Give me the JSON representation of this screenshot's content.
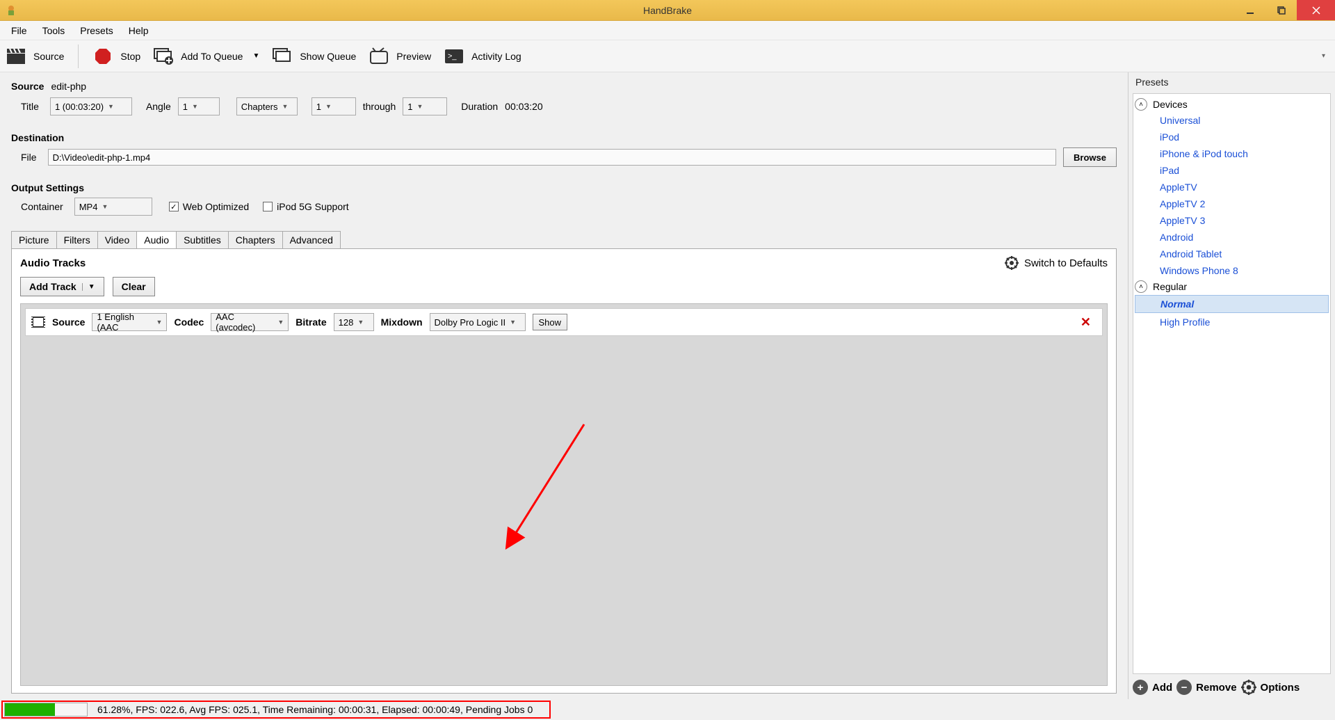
{
  "titlebar": {
    "title": "HandBrake"
  },
  "menubar": {
    "items": [
      "File",
      "Tools",
      "Presets",
      "Help"
    ]
  },
  "toolbar": {
    "source": "Source",
    "stop": "Stop",
    "addToQueue": "Add To Queue",
    "showQueue": "Show Queue",
    "preview": "Preview",
    "activityLog": "Activity Log"
  },
  "source": {
    "label": "Source",
    "value": "edit-php",
    "titleLabel": "Title",
    "titleValue": "1 (00:03:20)",
    "angleLabel": "Angle",
    "angleValue": "1",
    "rangeType": "Chapters",
    "fromValue": "1",
    "throughLabel": "through",
    "toValue": "1",
    "durationLabel": "Duration",
    "durationValue": "00:03:20"
  },
  "destination": {
    "label": "Destination",
    "fileLabel": "File",
    "fileValue": "D:\\Video\\edit-php-1.mp4",
    "browse": "Browse"
  },
  "output": {
    "label": "Output Settings",
    "containerLabel": "Container",
    "containerValue": "MP4",
    "webOptimizedLabel": "Web Optimized",
    "webOptimizedChecked": true,
    "ipod5gLabel": "iPod 5G Support",
    "ipod5gChecked": false
  },
  "tabs": [
    "Picture",
    "Filters",
    "Video",
    "Audio",
    "Subtitles",
    "Chapters",
    "Advanced"
  ],
  "activeTab": "Audio",
  "audioPanel": {
    "title": "Audio Tracks",
    "switchDefaults": "Switch to Defaults",
    "addTrack": "Add Track",
    "clear": "Clear",
    "track": {
      "sourceLabel": "Source",
      "sourceValue": "1 English (AAC",
      "codecLabel": "Codec",
      "codecValue": "AAC (avcodec)",
      "bitrateLabel": "Bitrate",
      "bitrateValue": "128",
      "mixdownLabel": "Mixdown",
      "mixdownValue": "Dolby Pro Logic II",
      "show": "Show"
    }
  },
  "presets": {
    "title": "Presets",
    "groups": [
      {
        "name": "Devices",
        "items": [
          "Universal",
          "iPod",
          "iPhone & iPod touch",
          "iPad",
          "AppleTV",
          "AppleTV 2",
          "AppleTV 3",
          "Android",
          "Android Tablet",
          "Windows Phone 8"
        ]
      },
      {
        "name": "Regular",
        "items": [
          "Normal",
          "High Profile"
        ]
      }
    ],
    "selected": "Normal",
    "footer": {
      "add": "Add",
      "remove": "Remove",
      "options": "Options"
    }
  },
  "status": {
    "progressPercent": 61.28,
    "text": "61.28%,  FPS: 022.6,  Avg FPS: 025.1,  Time Remaining: 00:00:31,  Elapsed: 00:00:49,  Pending Jobs 0"
  }
}
